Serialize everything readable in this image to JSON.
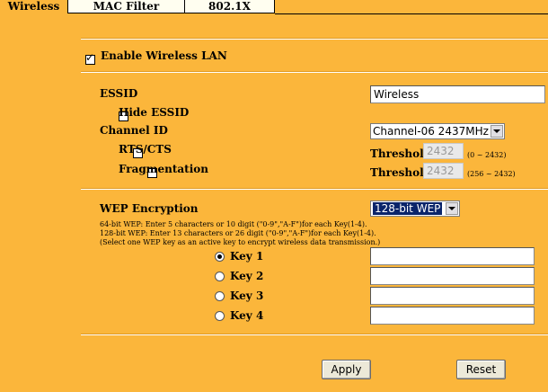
{
  "tabs": [
    {
      "label": "Wireless",
      "active": true
    },
    {
      "label": "MAC Filter",
      "active": false
    },
    {
      "label": "802.1X",
      "active": false
    }
  ],
  "enable_wireless": {
    "label": "Enable Wireless LAN",
    "checked": true
  },
  "essid": {
    "label": "ESSID",
    "value": "Wireless"
  },
  "hide_essid": {
    "label": "Hide ESSID",
    "checked": false
  },
  "channel": {
    "label": "Channel ID",
    "value": "Channel-06 2437MHz"
  },
  "rts": {
    "label": "RTS/CTS",
    "checked": false,
    "threshold_label": "Threshold",
    "threshold_value": "2432",
    "range": "(0 ~ 2432)"
  },
  "fragmentation": {
    "label": "Fragmentation",
    "checked": false,
    "threshold_label": "Threshold",
    "threshold_value": "2432",
    "range": "(256 ~ 2432)"
  },
  "wep": {
    "label": "WEP Encryption",
    "value": "128-bit WEP",
    "notes": [
      "64-bit WEP: Enter 5 characters or 10 digit (\"0-9\",\"A-F\")for each Key(1-4).",
      "128-bit WEP: Enter 13 characters or 26 digit (\"0-9\",\"A-F\")for each Key(1-4).",
      "(Select one WEP key as an active key to encrypt wireless data transmission.)"
    ],
    "keys": [
      {
        "label": "Key 1",
        "selected": true,
        "value": ""
      },
      {
        "label": "Key 2",
        "selected": false,
        "value": ""
      },
      {
        "label": "Key 3",
        "selected": false,
        "value": ""
      },
      {
        "label": "Key 4",
        "selected": false,
        "value": ""
      }
    ]
  },
  "buttons": {
    "apply": "Apply",
    "reset": "Reset"
  }
}
